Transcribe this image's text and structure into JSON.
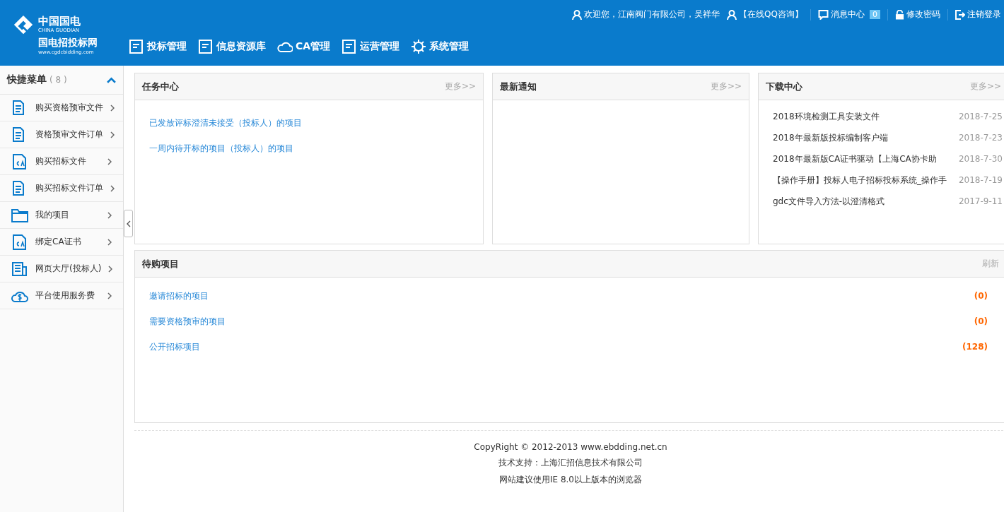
{
  "brand": {
    "name": "中国国电",
    "name_en": "CHINA GUODIAN",
    "site": "国电招投标网",
    "url": "www.cgdcbidding.com"
  },
  "nav": [
    "投标管理",
    "信息资源库",
    "CA管理",
    "运营管理",
    "系统管理"
  ],
  "top_links": {
    "welcome": "欢迎您，江南阀门有限公司，吴祥华",
    "qq": "【在线QQ咨询】",
    "messages": "消息中心",
    "message_count": "0",
    "password": "修改密码",
    "logout": "注销登录"
  },
  "sidebar": {
    "title": "快捷菜单",
    "count": "( 8 )",
    "expanded": true,
    "items": [
      {
        "label": "购买资格预审文件"
      },
      {
        "label": "资格预审文件订单"
      },
      {
        "label": "购买招标文件"
      },
      {
        "label": "购买招标文件订单"
      },
      {
        "label": "我的项目"
      },
      {
        "label": "绑定CA证书"
      },
      {
        "label": "网页大厅(投标人)"
      },
      {
        "label": "平台使用服务费"
      }
    ]
  },
  "panels": [
    {
      "title": "任务中心",
      "more": "更多>>",
      "links": [
        "已发放评标澄清未接受（投标人）的项目",
        "一周内待开标的项目（投标人）的项目"
      ]
    },
    {
      "title": "最新通知",
      "more": "更多>>"
    },
    {
      "title": "下载中心",
      "more": "更多>>",
      "files": [
        {
          "name": "2018环境检测工具安装文件",
          "date": "2018-7-25"
        },
        {
          "name": "2018年最新版投标编制客户端",
          "date": "2018-7-23"
        },
        {
          "name": "2018年最新版CA证书驱动【上海CA协卡助",
          "date": "2018-7-30"
        },
        {
          "name": "【操作手册】投标人电子招标投标系统_操作手",
          "date": "2018-7-19"
        },
        {
          "name": "gdc文件导入方法-以澄清格式",
          "date": "2017-9-11"
        }
      ]
    }
  ],
  "pending": {
    "title": "待购项目",
    "refresh": "刷新",
    "rows": [
      {
        "label": "邀请招标的项目",
        "count": "(0)"
      },
      {
        "label": "需要资格预审的项目",
        "count": "(0)"
      },
      {
        "label": "公开招标项目",
        "count": "(128)"
      }
    ]
  },
  "footer": [
    "CopyRight © 2012-2013 www.ebdding.net.cn",
    "技术支持：上海汇招信息技术有限公司",
    "网站建议使用IE 8.0以上版本的浏览器"
  ]
}
